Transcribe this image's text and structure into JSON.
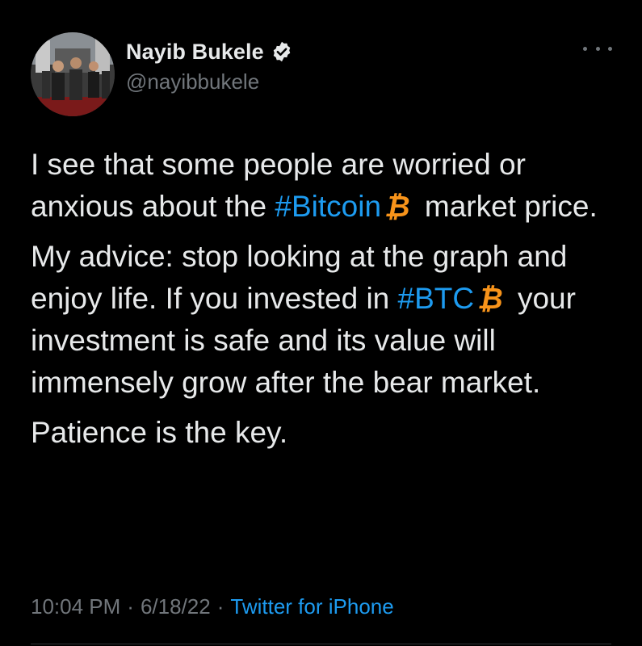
{
  "tweet": {
    "author": {
      "display_name": "Nayib Bukele",
      "handle": "@nayibbukele",
      "verified": true,
      "avatar_icon": "profile-photo",
      "verified_icon": "verified-badge-icon",
      "more_icon": "more-options-icon"
    },
    "paragraphs": [
      {
        "parts": [
          {
            "kind": "text",
            "value": "I see that some people are worried or anxious about the "
          },
          {
            "kind": "hashtag",
            "value": "#Bitcoin"
          },
          {
            "kind": "emoji",
            "value": "₿",
            "name": "bitcoin-emoji"
          },
          {
            "kind": "text",
            "value": " market price."
          }
        ]
      },
      {
        "parts": [
          {
            "kind": "text",
            "value": "My advice: stop looking at the graph and enjoy life. If you invested in "
          },
          {
            "kind": "hashtag",
            "value": "#BTC"
          },
          {
            "kind": "emoji",
            "value": "₿",
            "name": "bitcoin-emoji"
          },
          {
            "kind": "text",
            "value": " your investment is safe and its value will immensely grow after the bear market."
          }
        ]
      },
      {
        "parts": [
          {
            "kind": "text",
            "value": "Patience is the key."
          }
        ]
      }
    ],
    "meta": {
      "time": "10:04 PM",
      "separator": "·",
      "date": "6/18/22",
      "source": "Twitter for iPhone"
    }
  },
  "colors": {
    "background": "#000000",
    "text": "#e7e9ea",
    "secondary": "#71767b",
    "link": "#1d9bf0",
    "bitcoin": "#f7931a"
  }
}
